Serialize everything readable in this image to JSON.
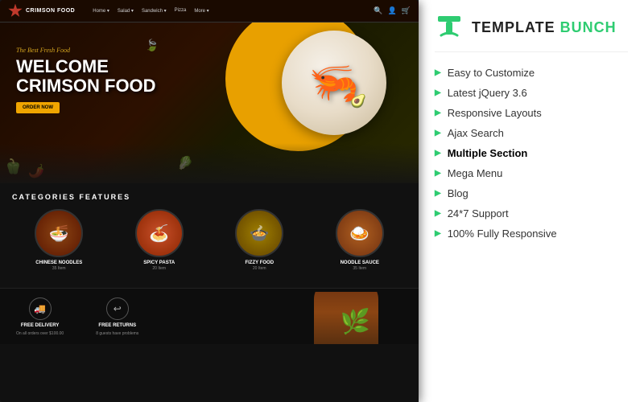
{
  "brand": {
    "name_part1": "TEMPLATE",
    "name_part2": " BUNCH",
    "logo_alt": "TemplateBunch logo"
  },
  "site": {
    "logo_text": "CRIMSON FOOD",
    "nav_links": [
      "Home",
      "Salad",
      "Sandwich",
      "Pizza",
      "More"
    ],
    "hero": {
      "subtitle": "The Best Fresh Food",
      "title_line1": "WELCOME",
      "title_line2": "CRIMSON FOOD",
      "button_label": "ORDER NOW"
    },
    "categories_title": "CATEGORIES FEATURES",
    "categories": [
      {
        "name": "CHINESE NOODLES",
        "count": "35 Item",
        "emoji": "🍜"
      },
      {
        "name": "SPICY PASTA",
        "count": "20 Item",
        "emoji": "🍝"
      },
      {
        "name": "FIZZY FOOD",
        "count": "20 Item",
        "emoji": "🍲"
      },
      {
        "name": "NOODLE SAUCE",
        "count": "35 Item",
        "emoji": "🍛"
      }
    ],
    "delivery": [
      {
        "icon": "🚚",
        "title": "FREE DELIVERY",
        "desc": "On all orders over $100.00"
      },
      {
        "icon": "↩",
        "title": "FREE RETURNS",
        "desc": "8 guests have problems"
      }
    ]
  },
  "features": [
    {
      "text": "Easy to Customize",
      "highlighted": false
    },
    {
      "text": "Latest jQuery 3.6",
      "highlighted": false
    },
    {
      "text": "Responsive Layouts",
      "highlighted": false
    },
    {
      "text": "Ajax Search",
      "highlighted": false
    },
    {
      "text": "Multiple Section",
      "highlighted": true
    },
    {
      "text": "Mega Menu",
      "highlighted": false
    },
    {
      "text": "Blog",
      "highlighted": false
    },
    {
      "text": "24*7 Support",
      "highlighted": false
    },
    {
      "text": "100% Fully Responsive",
      "highlighted": false
    }
  ],
  "colors": {
    "accent_green": "#2ecc71",
    "accent_yellow": "#f0a500",
    "hero_bg_dark": "#1a0a00",
    "site_bg": "#111111"
  }
}
